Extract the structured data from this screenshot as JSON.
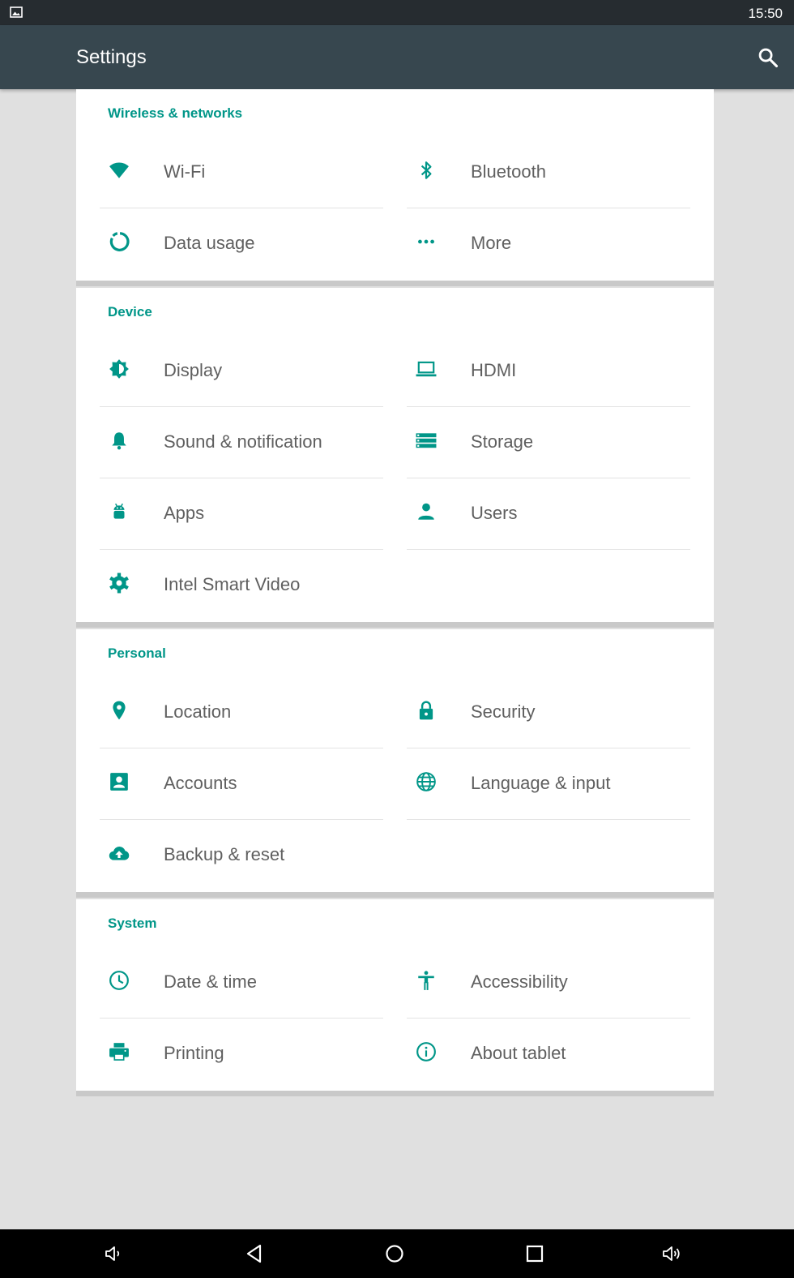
{
  "status_bar": {
    "time": "15:50"
  },
  "app_bar": {
    "title": "Settings"
  },
  "sections": [
    {
      "title": "Wireless & networks",
      "items": [
        {
          "label": "Wi-Fi",
          "icon": "wifi-icon"
        },
        {
          "label": "Bluetooth",
          "icon": "bluetooth-icon"
        },
        {
          "label": "Data usage",
          "icon": "data-usage-icon"
        },
        {
          "label": "More",
          "icon": "more-icon"
        }
      ]
    },
    {
      "title": "Device",
      "items": [
        {
          "label": "Display",
          "icon": "brightness-icon"
        },
        {
          "label": "HDMI",
          "icon": "laptop-icon"
        },
        {
          "label": "Sound & notification",
          "icon": "bell-icon"
        },
        {
          "label": "Storage",
          "icon": "storage-icon"
        },
        {
          "label": "Apps",
          "icon": "android-icon"
        },
        {
          "label": "Users",
          "icon": "person-icon"
        },
        {
          "label": "Intel Smart Video",
          "icon": "gear-icon"
        }
      ]
    },
    {
      "title": "Personal",
      "items": [
        {
          "label": "Location",
          "icon": "location-pin-icon"
        },
        {
          "label": "Security",
          "icon": "lock-icon"
        },
        {
          "label": "Accounts",
          "icon": "account-box-icon"
        },
        {
          "label": "Language & input",
          "icon": "globe-icon"
        },
        {
          "label": "Backup & reset",
          "icon": "cloud-upload-icon"
        }
      ]
    },
    {
      "title": "System",
      "items": [
        {
          "label": "Date & time",
          "icon": "clock-icon"
        },
        {
          "label": "Accessibility",
          "icon": "accessibility-icon"
        },
        {
          "label": "Printing",
          "icon": "printer-icon"
        },
        {
          "label": "About tablet",
          "icon": "info-icon"
        }
      ]
    }
  ],
  "nav_bar": {
    "buttons": [
      "volume-down-icon",
      "back-icon",
      "home-icon",
      "recents-icon",
      "volume-up-icon"
    ]
  },
  "colors": {
    "accent": "#009688",
    "app_bar": "#37474f",
    "status_bar": "#262c30",
    "background": "#e0e0e0",
    "item_text": "#5f5f5f"
  }
}
